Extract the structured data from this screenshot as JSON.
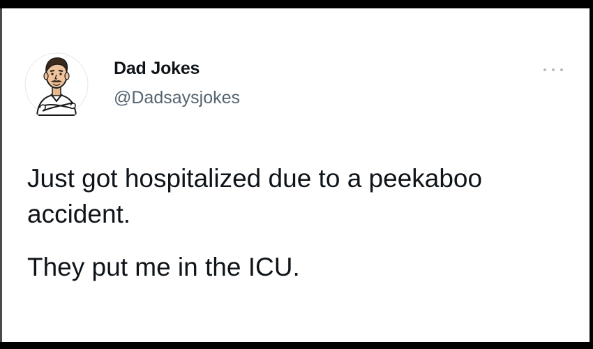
{
  "tweet": {
    "author": {
      "display_name": "Dad Jokes",
      "handle": "@Dadsaysjokes",
      "avatar_icon": "cartoon-dad-avatar-icon"
    },
    "more_icon": "more-options-icon",
    "text_lines": [
      "Just got hospitalized due to a peekaboo accident.",
      "They put me in the ICU."
    ]
  },
  "colors": {
    "background_frame": "#000000",
    "card": "#ffffff",
    "text_primary": "#0f1419",
    "text_secondary": "#536471",
    "more_dots": "#b4bcc3"
  }
}
